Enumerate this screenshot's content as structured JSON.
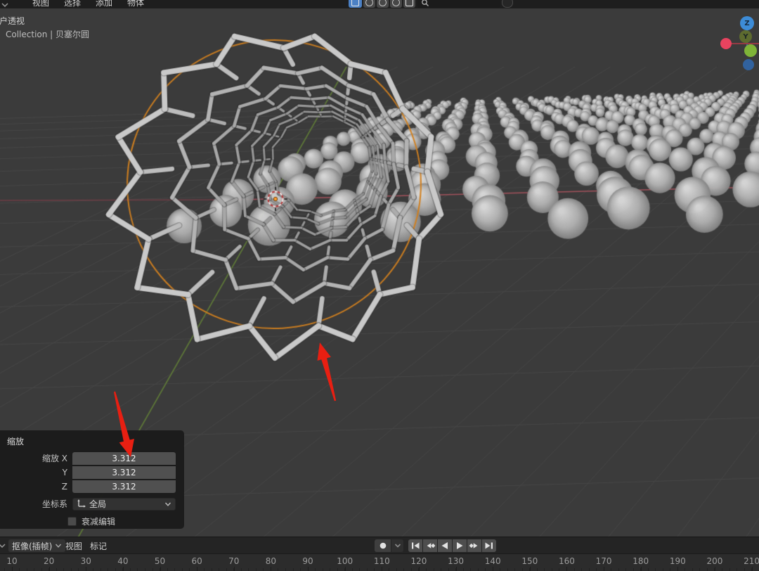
{
  "header": {
    "menus": [
      "视图",
      "选择",
      "添加",
      "物体"
    ],
    "center_icons": [
      "proportional-editing-icon",
      "snap-icon",
      "snap-target-icon",
      "gizmos-icon",
      "overlays-icon"
    ],
    "search_value": "",
    "accent_blue": "#4b80c4"
  },
  "viewport": {
    "view_label": "户透视",
    "breadcrumb": "Collection | 贝塞尔圆",
    "gizmo_axes": [
      {
        "label": "Z",
        "color": "#3d8cd7"
      },
      {
        "label": "Y",
        "color": "#5d6b2f"
      },
      {
        "label": "",
        "color": "#e8435f"
      },
      {
        "label": "",
        "color": "#7fb438"
      },
      {
        "label": "",
        "color": "#31629e"
      }
    ]
  },
  "operator_panel": {
    "title": "缩放",
    "fields": [
      {
        "label": "缩放 X",
        "value": "3.312"
      },
      {
        "label": "Y",
        "value": "3.312"
      },
      {
        "label": "Z",
        "value": "3.312"
      }
    ],
    "orientation_label": "坐标系",
    "orientation_value": "全局",
    "falloff_label": "衰减编辑"
  },
  "timeline": {
    "keying_menu": "抠像(插帧)",
    "menus": [
      "视图",
      "标记"
    ],
    "transport": [
      "record",
      "record-options",
      "jump-first",
      "prev-keyframe",
      "play-reverse",
      "play",
      "next-keyframe",
      "jump-last"
    ],
    "ruler_ticks": [
      10,
      20,
      30,
      40,
      50,
      60,
      70,
      80,
      90,
      100,
      110,
      120,
      130,
      140,
      150,
      160,
      170,
      180,
      190,
      200,
      210
    ]
  },
  "scene": {
    "colors": {
      "viewport_bg": "#3b3b3b",
      "grid_line": "#474747",
      "axis_x_red": "#a4525c",
      "axis_x_red_dim": "#6e3d45",
      "axis_y_green": "#5f7a38",
      "sphere_hi": "#d6d6d6",
      "sphere_mid": "#b2b2b2",
      "sphere_lo": "#7e7e7e",
      "tube_near": "#cfcfcf",
      "tube_far": "#909090",
      "tube_shadow": "rgba(35,35,35,0.35)",
      "bezier_orange": "#d1801f",
      "cursor_red": "#b43a3a",
      "cursor_white": "#ededed",
      "origin_orange": "#ff9e2d"
    }
  },
  "annotations": {
    "arrow_color": "#e81f12"
  }
}
